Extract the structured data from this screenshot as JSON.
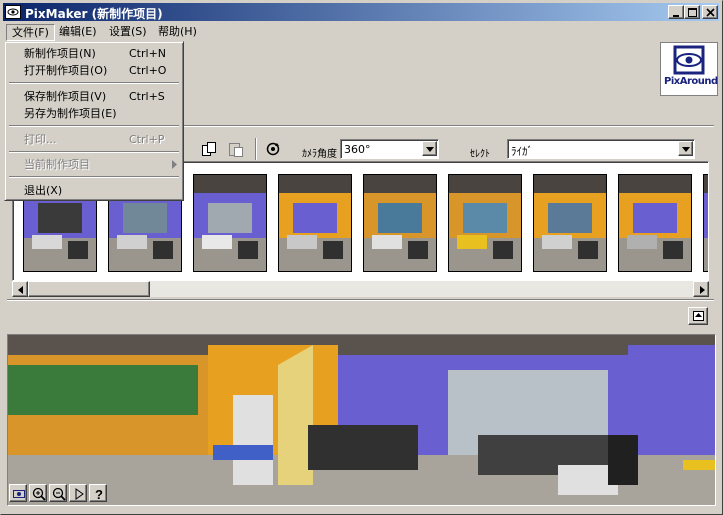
{
  "window": {
    "title": "PixMaker (新制作项目)"
  },
  "menubar": {
    "items": [
      "文件(F)",
      "编辑(E)",
      "设置(S)",
      "帮助(H)"
    ]
  },
  "file_menu": {
    "new": {
      "label": "新制作项目(N)",
      "accel": "Ctrl+N"
    },
    "open": {
      "label": "打开制作项目(O)",
      "accel": "Ctrl+O"
    },
    "save": {
      "label": "保存制作项目(V)",
      "accel": "Ctrl+S"
    },
    "save_as": {
      "label": "另存为制作项目(E)"
    },
    "print": {
      "label": "打印...",
      "accel": "Ctrl+P"
    },
    "recent": {
      "label": "当前制作项目"
    },
    "exit": {
      "label": "退出(X)"
    }
  },
  "logo": {
    "text": "PixAround"
  },
  "toolbar": {
    "field1_label": "ｶﾒﾗ角度",
    "field1_value": "360°",
    "field2_label": "ｾﾚｸﾄ",
    "field2_value": "ﾗｲｶﾞ"
  },
  "thumbnails": {
    "count": 9
  },
  "colors": {
    "title_start": "#0a246a",
    "title_end": "#a6caf0",
    "wall_purple": "#6a5fd0",
    "wall_orange": "#e8a020"
  },
  "icons": {
    "app": "pixmaker-app-icon",
    "minimize": "minimize-icon",
    "maximize": "maximize-icon",
    "close": "close-icon"
  }
}
